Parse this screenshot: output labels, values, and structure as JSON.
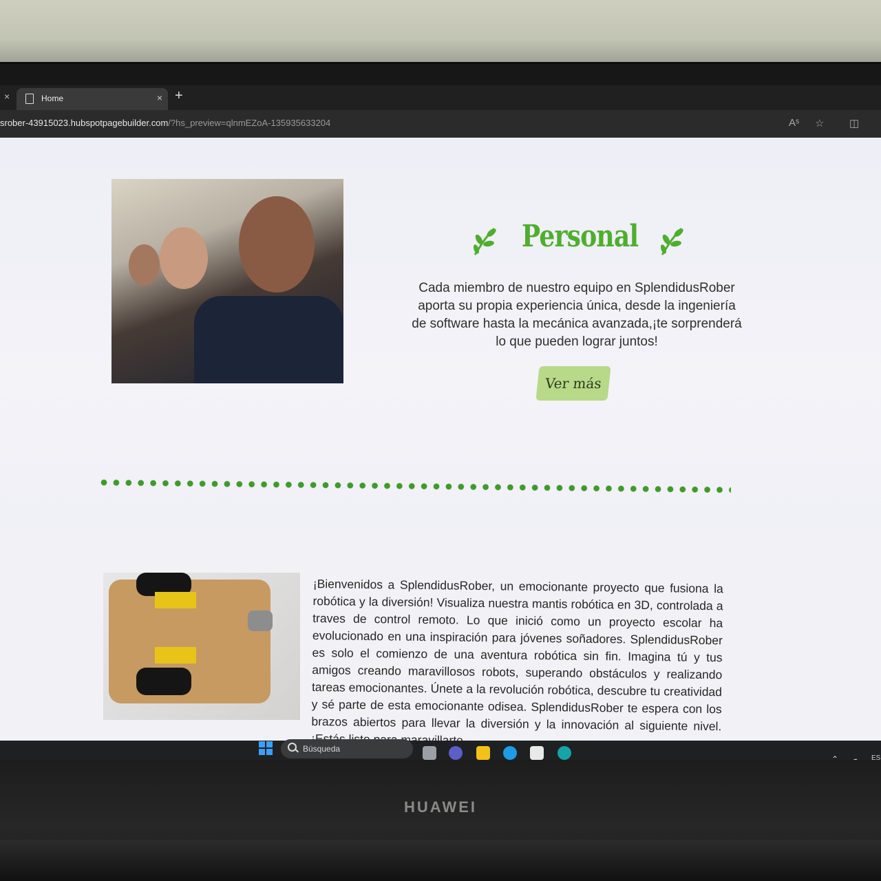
{
  "browser": {
    "tab_title": "Home",
    "url_host": "srober-43915023.hubspotpagebuilder.com",
    "url_query": "/?hs_preview=qlnmEZoA-135935633204",
    "new_tab_symbol": "+",
    "close_symbol": "×"
  },
  "personal_section": {
    "heading": "Personal",
    "description": "Cada miembro de nuestro equipo en SplendidusRober aporta su propia experiencia única, desde la ingeniería de software hasta la mecánica avanzada,¡te sorprenderá lo que pueden lograr juntos!",
    "button_label": "Ver más",
    "accent_color": "#4fae2e",
    "button_color": "#b8d987"
  },
  "intro_section": {
    "text": "¡Bienvenidos a SplendidusRober, un emocionante proyecto que fusiona la robótica y la diversión! Visualiza nuestra mantis robótica en 3D, controlada a traves de control remoto. Lo que inició como un proyecto escolar ha evolucionado en una inspiración para jóvenes soñadores. SplendidusRober es solo el comienzo de una aventura robótica sin fin. Imagina tú y tus amigos creando maravillosos robots, superando obstáculos y realizando tareas emocionantes. Únete a la revolución robótica, descubre tu creatividad y sé parte de esta emocionante odisea. SplendidusRober te espera con los brazos abiertos para llevar la diversión y la innovación al siguiente nivel. ¡Estás listo para maravillarte"
  },
  "taskbar": {
    "search_placeholder": "Búsqueda",
    "tray_lang": "ES"
  },
  "device": {
    "brand": "HUAWEI"
  },
  "icons": [
    "document-icon",
    "close-icon",
    "plus-icon",
    "read-aloud-icon",
    "star-icon",
    "split-screen-icon",
    "leaf-icon",
    "windows-start-icon",
    "search-icon",
    "chevron-up-icon"
  ]
}
